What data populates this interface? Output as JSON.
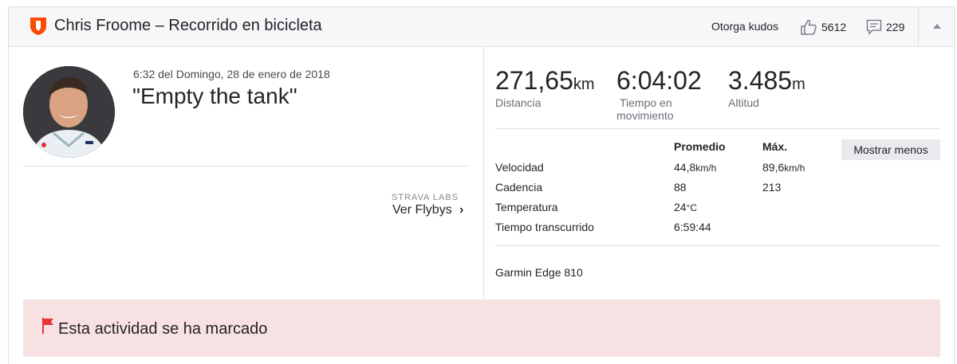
{
  "header": {
    "title": "Chris Froome – Recorrido en bicicleta",
    "kudos_prompt": "Otorga kudos",
    "kudos_count": "5612",
    "comment_count": "229",
    "icons": {
      "activity": "shield-icon",
      "kudos": "thumbs-up-icon",
      "comments": "comment-icon",
      "collapse": "caret-up-icon"
    },
    "brand_color": "#fc4c02"
  },
  "activity": {
    "date": "6:32 del Domingo, 28 de enero de 2018",
    "name": "\"Empty the tank\"",
    "labs_label": "STRAVA LABS",
    "flybys_label": "Ver Flybys",
    "flybys_chevron": "›"
  },
  "stats": {
    "distance": {
      "value": "271,65",
      "unit": "km",
      "label": "Distancia"
    },
    "moving_time": {
      "value": "6:04:02",
      "label_line1": "Tiempo en",
      "label_line2": "movimiento"
    },
    "elevation": {
      "value": "3.485",
      "unit": "m",
      "label": "Altitud"
    }
  },
  "details": {
    "col_avg": "Promedio",
    "col_max": "Máx.",
    "toggle_label": "Mostrar menos",
    "rows": [
      {
        "label": "Velocidad",
        "avg": "44,8",
        "avg_unit": "km/h",
        "max": "89,6",
        "max_unit": "km/h"
      },
      {
        "label": "Cadencia",
        "avg": "88",
        "max": "213"
      },
      {
        "label": "Temperatura",
        "avg": "24",
        "avg_unit": "°C"
      },
      {
        "label": "Tiempo transcurrido",
        "avg": "6:59:44"
      }
    ],
    "device": "Garmin Edge 810"
  },
  "flag": {
    "text": "Esta actividad se ha marcado",
    "icon": "flag-icon",
    "background": "#f8e1e3",
    "icon_color": "#e8333a"
  }
}
